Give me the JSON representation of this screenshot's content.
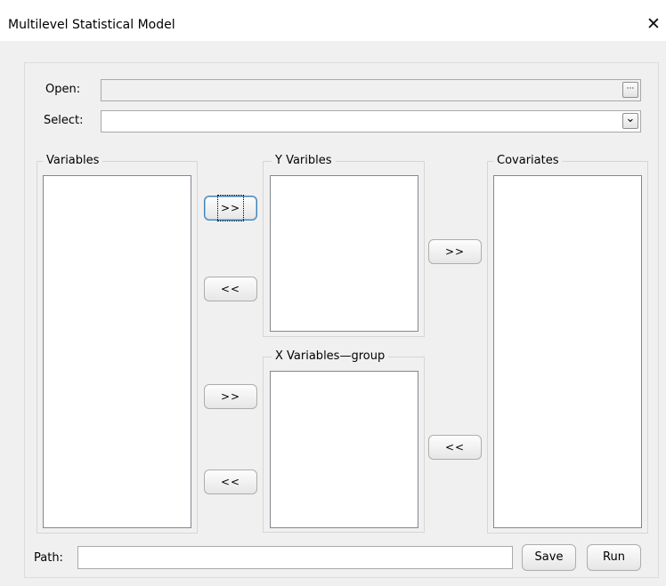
{
  "window": {
    "title": "Multilevel Statistical Model",
    "close_symbol": "✕"
  },
  "open": {
    "label": "Open:",
    "value": "",
    "browse_symbol": "···"
  },
  "select": {
    "label": "Select:",
    "value": "",
    "dropdown_symbol": "⌄"
  },
  "groups": {
    "variables": {
      "label": "Variables",
      "items": []
    },
    "y_variables": {
      "label": "Y Varibles",
      "items": []
    },
    "x_variables": {
      "label": "X Variables—group",
      "items": []
    },
    "covariates": {
      "label": "Covariates",
      "items": []
    }
  },
  "buttons": {
    "add_y": ">>",
    "remove_y": "<<",
    "add_x": ">>",
    "remove_x": "<<",
    "add_covariate": ">>",
    "remove_covariate": "<<",
    "save": "Save",
    "run": "Run"
  },
  "path": {
    "label": "Path:",
    "value": ""
  },
  "colors": {
    "background": "#f0f0f0",
    "titlebar": "#ffffff",
    "focus_border": "#3c7fb1"
  }
}
